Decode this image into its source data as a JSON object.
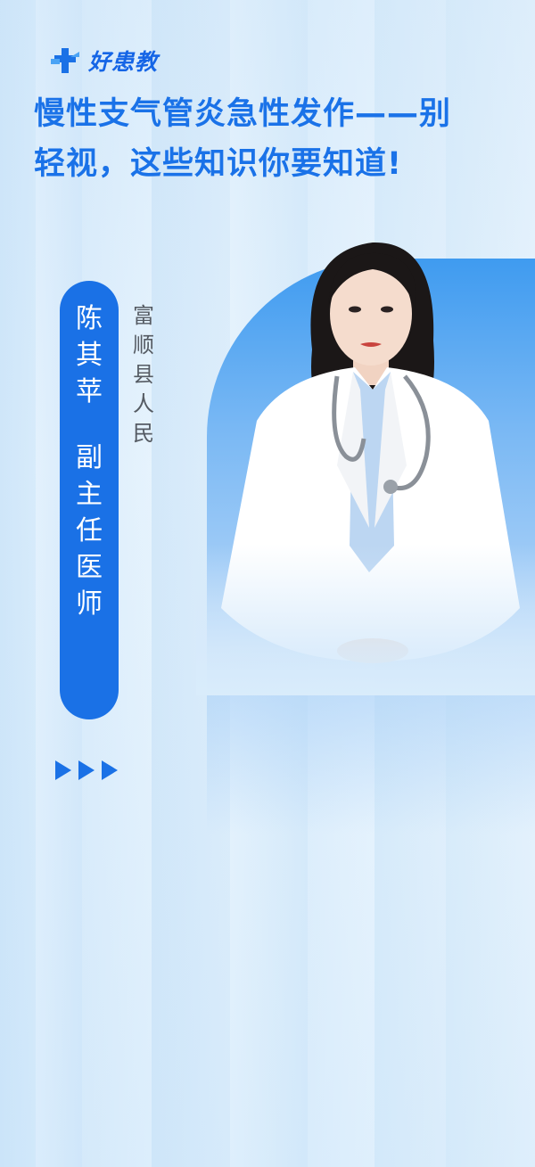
{
  "brand": {
    "logo_text": "好患教",
    "logo_icon": "medical-cross-logo-icon",
    "accent_color": "#1a71e6"
  },
  "title": {
    "line1": "慢性支气管炎急性发作——别",
    "line2": "轻视，这些知识你要知道!"
  },
  "doctor": {
    "name": "陈其苹",
    "position": "副主任医师",
    "hospital": "富顺县人民"
  },
  "decor": {
    "arrow_icon": "play-triangle-icon",
    "arrow_count": 3
  }
}
